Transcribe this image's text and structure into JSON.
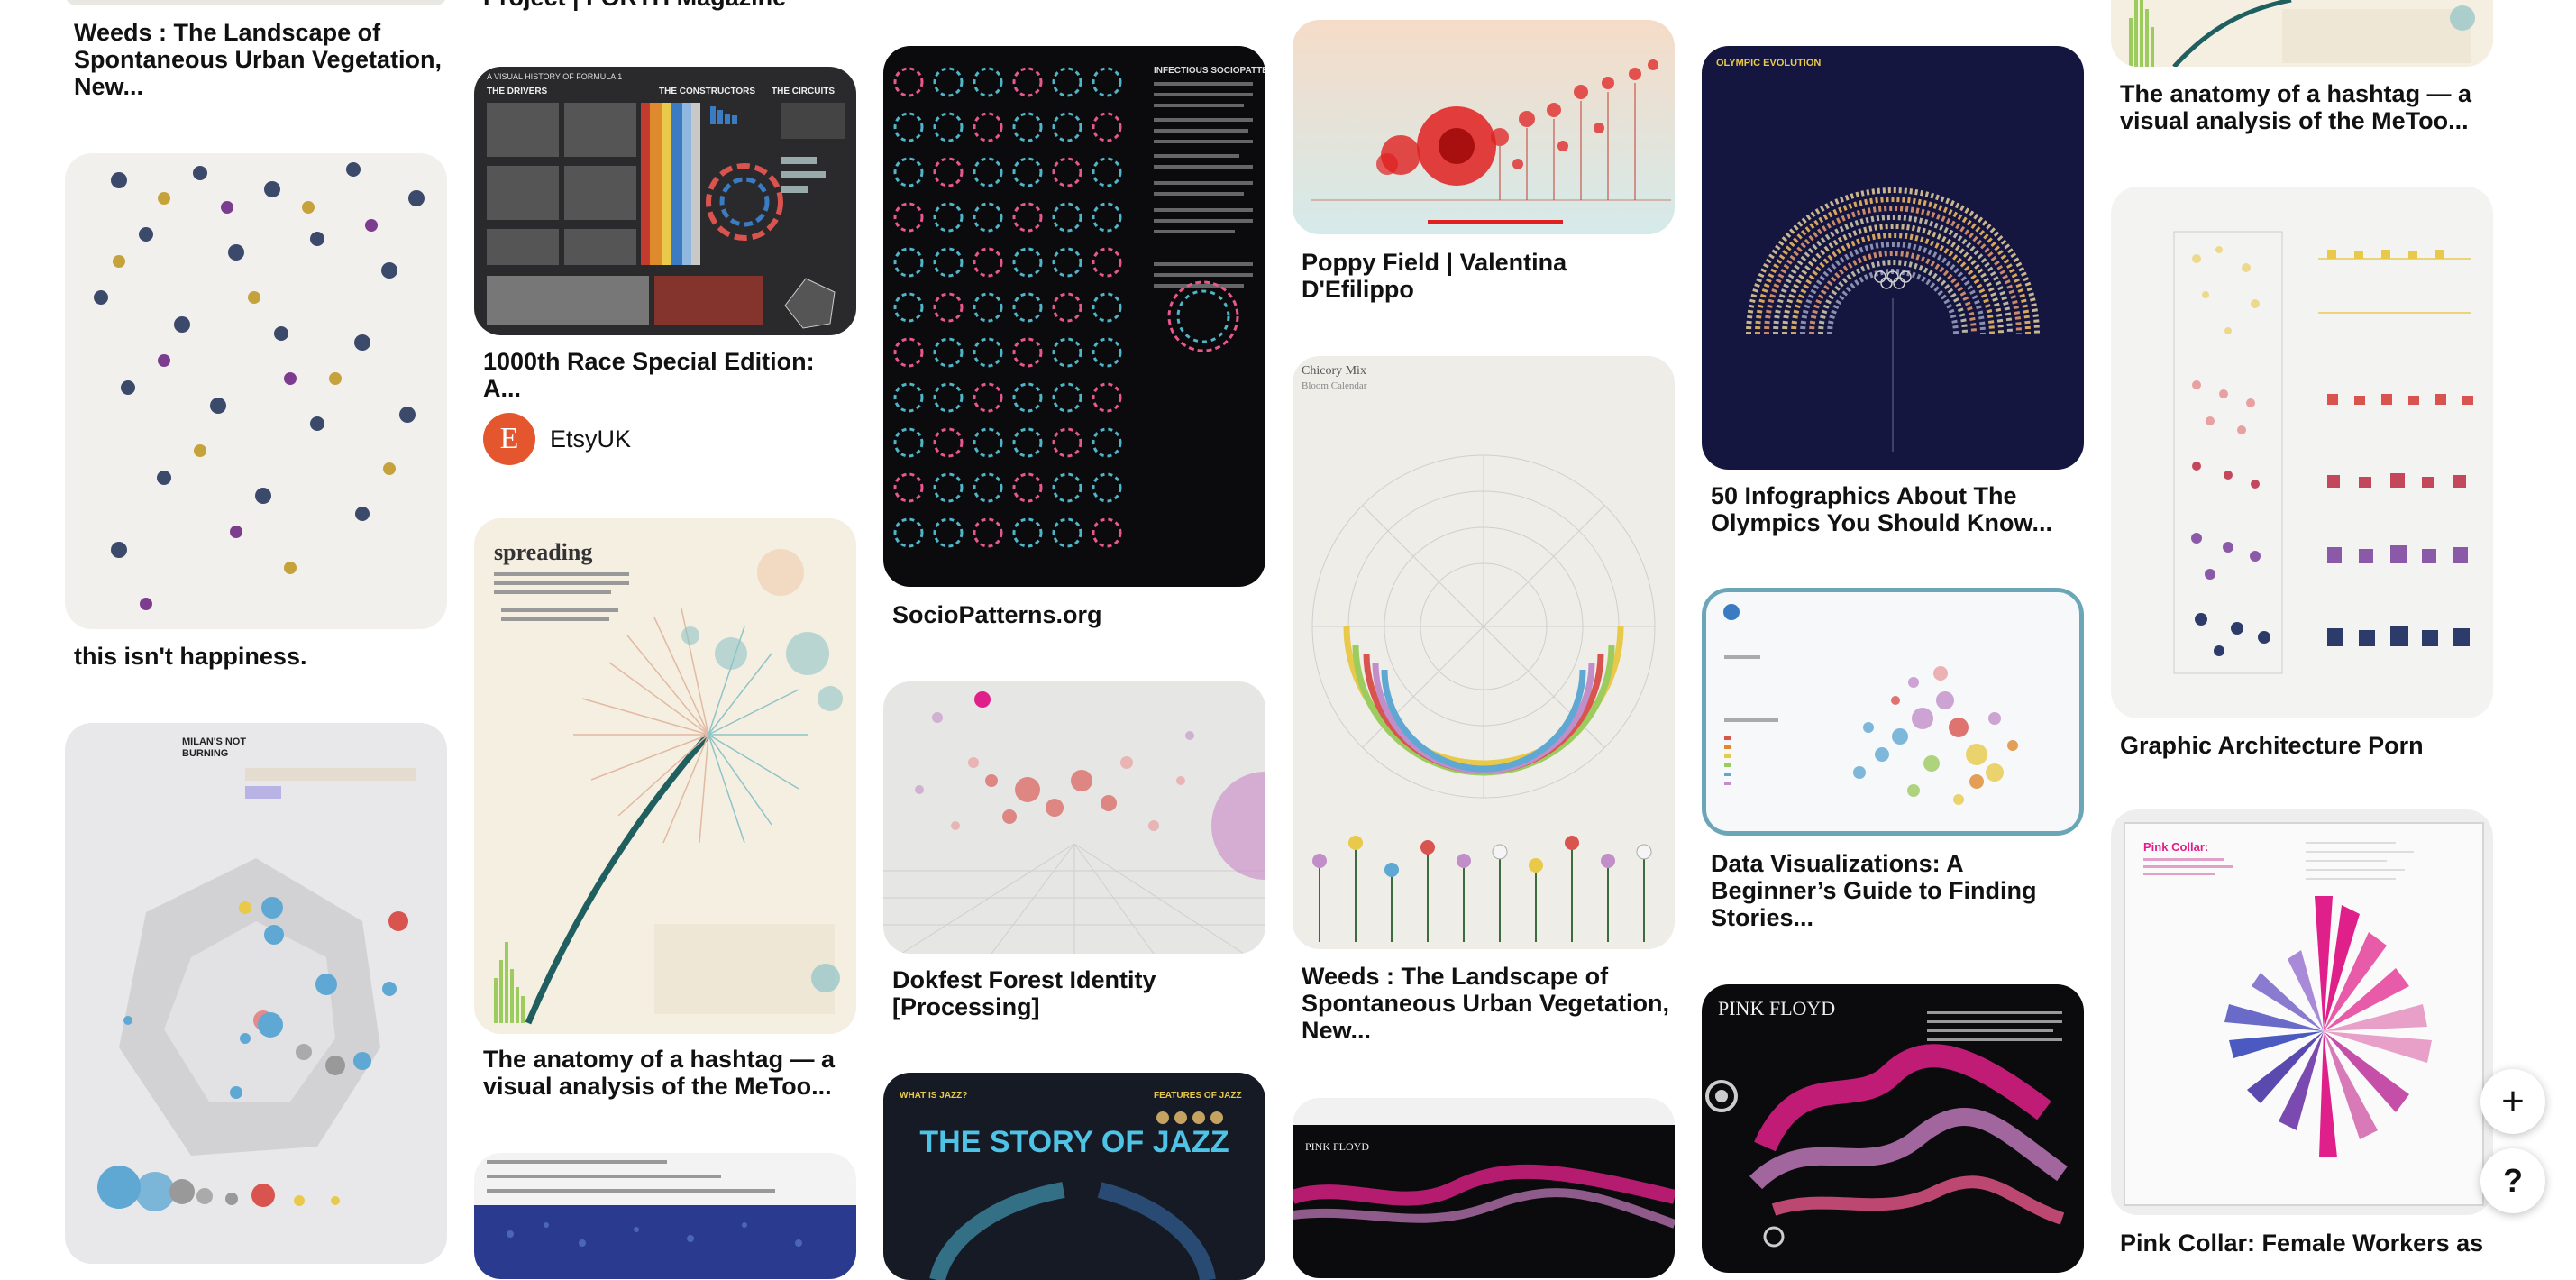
{
  "pins": {
    "c1_top": {
      "title_l1": "Weeds : The Landscape of",
      "title_l2": "Spontaneous Urban Vegetation,",
      "title_l3": "New..."
    },
    "c1_people": {
      "title": "this isn't happiness."
    },
    "c1_chart": {
      "title_l1": "MILAN'S NOT",
      "title_l2": "BURNING"
    },
    "c2_top": {
      "title": "Project | FORTH Magazine"
    },
    "c2_f1": {
      "title_l1": "1000th Race Special Edition:",
      "title_l2": "A...",
      "source_initial": "E",
      "source_name": "EtsyUK",
      "img_l1": "A VISUAL HISTORY OF FORMULA 1",
      "img_drivers": "THE DRIVERS",
      "img_constructors": "THE CONSTRUCTORS",
      "img_circuits": "THE CIRCUITS"
    },
    "c2_hashtag": {
      "title_l1": "The anatomy of a hashtag — a",
      "title_l2": "visual analysis of the MeToo...",
      "img_heading": "spreading"
    },
    "c3_socio": {
      "title": "SocioPatterns.org",
      "img_heading": "INFECTIOUS SOCIOPATTERNS"
    },
    "c3_dokfest": {
      "title_l1": "Dokfest Forest Identity",
      "title_l2": "[Processing]"
    },
    "c3_jazz": {
      "img_heading": "THE STORY OF JAZZ",
      "img_left": "WHAT IS JAZZ?",
      "img_right": "FEATURES OF JAZZ"
    },
    "c4_poppy": {
      "title_l1": "Poppy Field | Valentina",
      "title_l2": "D'Efilippo"
    },
    "c4_weeds": {
      "title_l1": "Weeds : The Landscape of",
      "title_l2": "Spontaneous Urban Vegetation,",
      "title_l3": "New...",
      "img_heading": "Chicory Mix",
      "img_sub": "Bloom Calendar"
    },
    "c4_floyd": {
      "img_heading": "PINK FLOYD"
    },
    "c5_olympic": {
      "title_l1": "50 Infographics About The",
      "title_l2": "Olympics You Should Know...",
      "img_heading": "OLYMPIC EVOLUTION"
    },
    "c5_dataviz": {
      "title_l1": "Data Visualizations: A",
      "title_l2": "Beginner’s Guide to Finding",
      "title_l3": "Stories..."
    },
    "c5_floyd": {
      "img_heading": "PINK FLOYD"
    },
    "c6_hashtag": {
      "title_l1": "The anatomy of a hashtag — a",
      "title_l2": "visual analysis of the MeToo..."
    },
    "c6_arch": {
      "title": "Graphic Architecture Porn"
    },
    "c6_pink": {
      "title": "Pink Collar: Female Workers as",
      "img_heading": "Pink Collar:"
    }
  },
  "fabs": {
    "add_label": "+",
    "help_label": "?"
  },
  "colors": {
    "accent_pink": "#e0208a",
    "etsy_orange": "#e4572e",
    "olympic_navy": "#14163f"
  }
}
